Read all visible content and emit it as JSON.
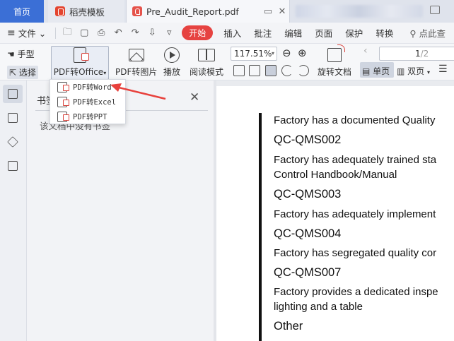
{
  "tabs": {
    "home": "首页",
    "template": "稻壳模板",
    "document": "Pre_Audit_Report.pdf"
  },
  "menubar": {
    "hamburger": "≡",
    "file": "文件",
    "start": "开始",
    "items": [
      "插入",
      "批注",
      "编辑",
      "页面",
      "保护",
      "转换"
    ],
    "search": "点此查"
  },
  "toolbar": {
    "hand": "手型",
    "select": "选择",
    "pdf_to_office": "PDF转Office",
    "pdf_to_image": "PDF转图片",
    "play": "播放",
    "read_mode": "阅读模式",
    "zoom": "117.51%",
    "rotate_doc": "旋转文档",
    "single_page": "单页",
    "double_page": "双页",
    "page_current": "1",
    "page_total": "/2"
  },
  "dropdown": {
    "items": [
      "PDF转Word",
      "PDF转Excel",
      "PDF转PPT"
    ]
  },
  "panel": {
    "title": "书签",
    "empty_text": "该文档中没有书签"
  },
  "document": {
    "lines": [
      {
        "kind": "body",
        "text": "Factory has a documented Quality"
      },
      {
        "kind": "head",
        "text": "QC-QMS002"
      },
      {
        "kind": "body",
        "text": "Factory has adequately trained sta"
      },
      {
        "kind": "body",
        "text": "Control Handbook/Manual"
      },
      {
        "kind": "head",
        "text": "QC-QMS003"
      },
      {
        "kind": "body",
        "text": "Factory has adequately implement"
      },
      {
        "kind": "head",
        "text": "QC-QMS004"
      },
      {
        "kind": "body",
        "text": "Factory has segregated quality cor"
      },
      {
        "kind": "head",
        "text": "QC-QMS007"
      },
      {
        "kind": "body",
        "text": "Factory provides a dedicated inspe"
      },
      {
        "kind": "body",
        "text": "lighting and a table"
      },
      {
        "kind": "head",
        "text": "Other"
      }
    ]
  },
  "colors": {
    "accent_blue": "#3b6fd6",
    "start_red": "#e64341",
    "annotation_red": "#e8413c"
  }
}
